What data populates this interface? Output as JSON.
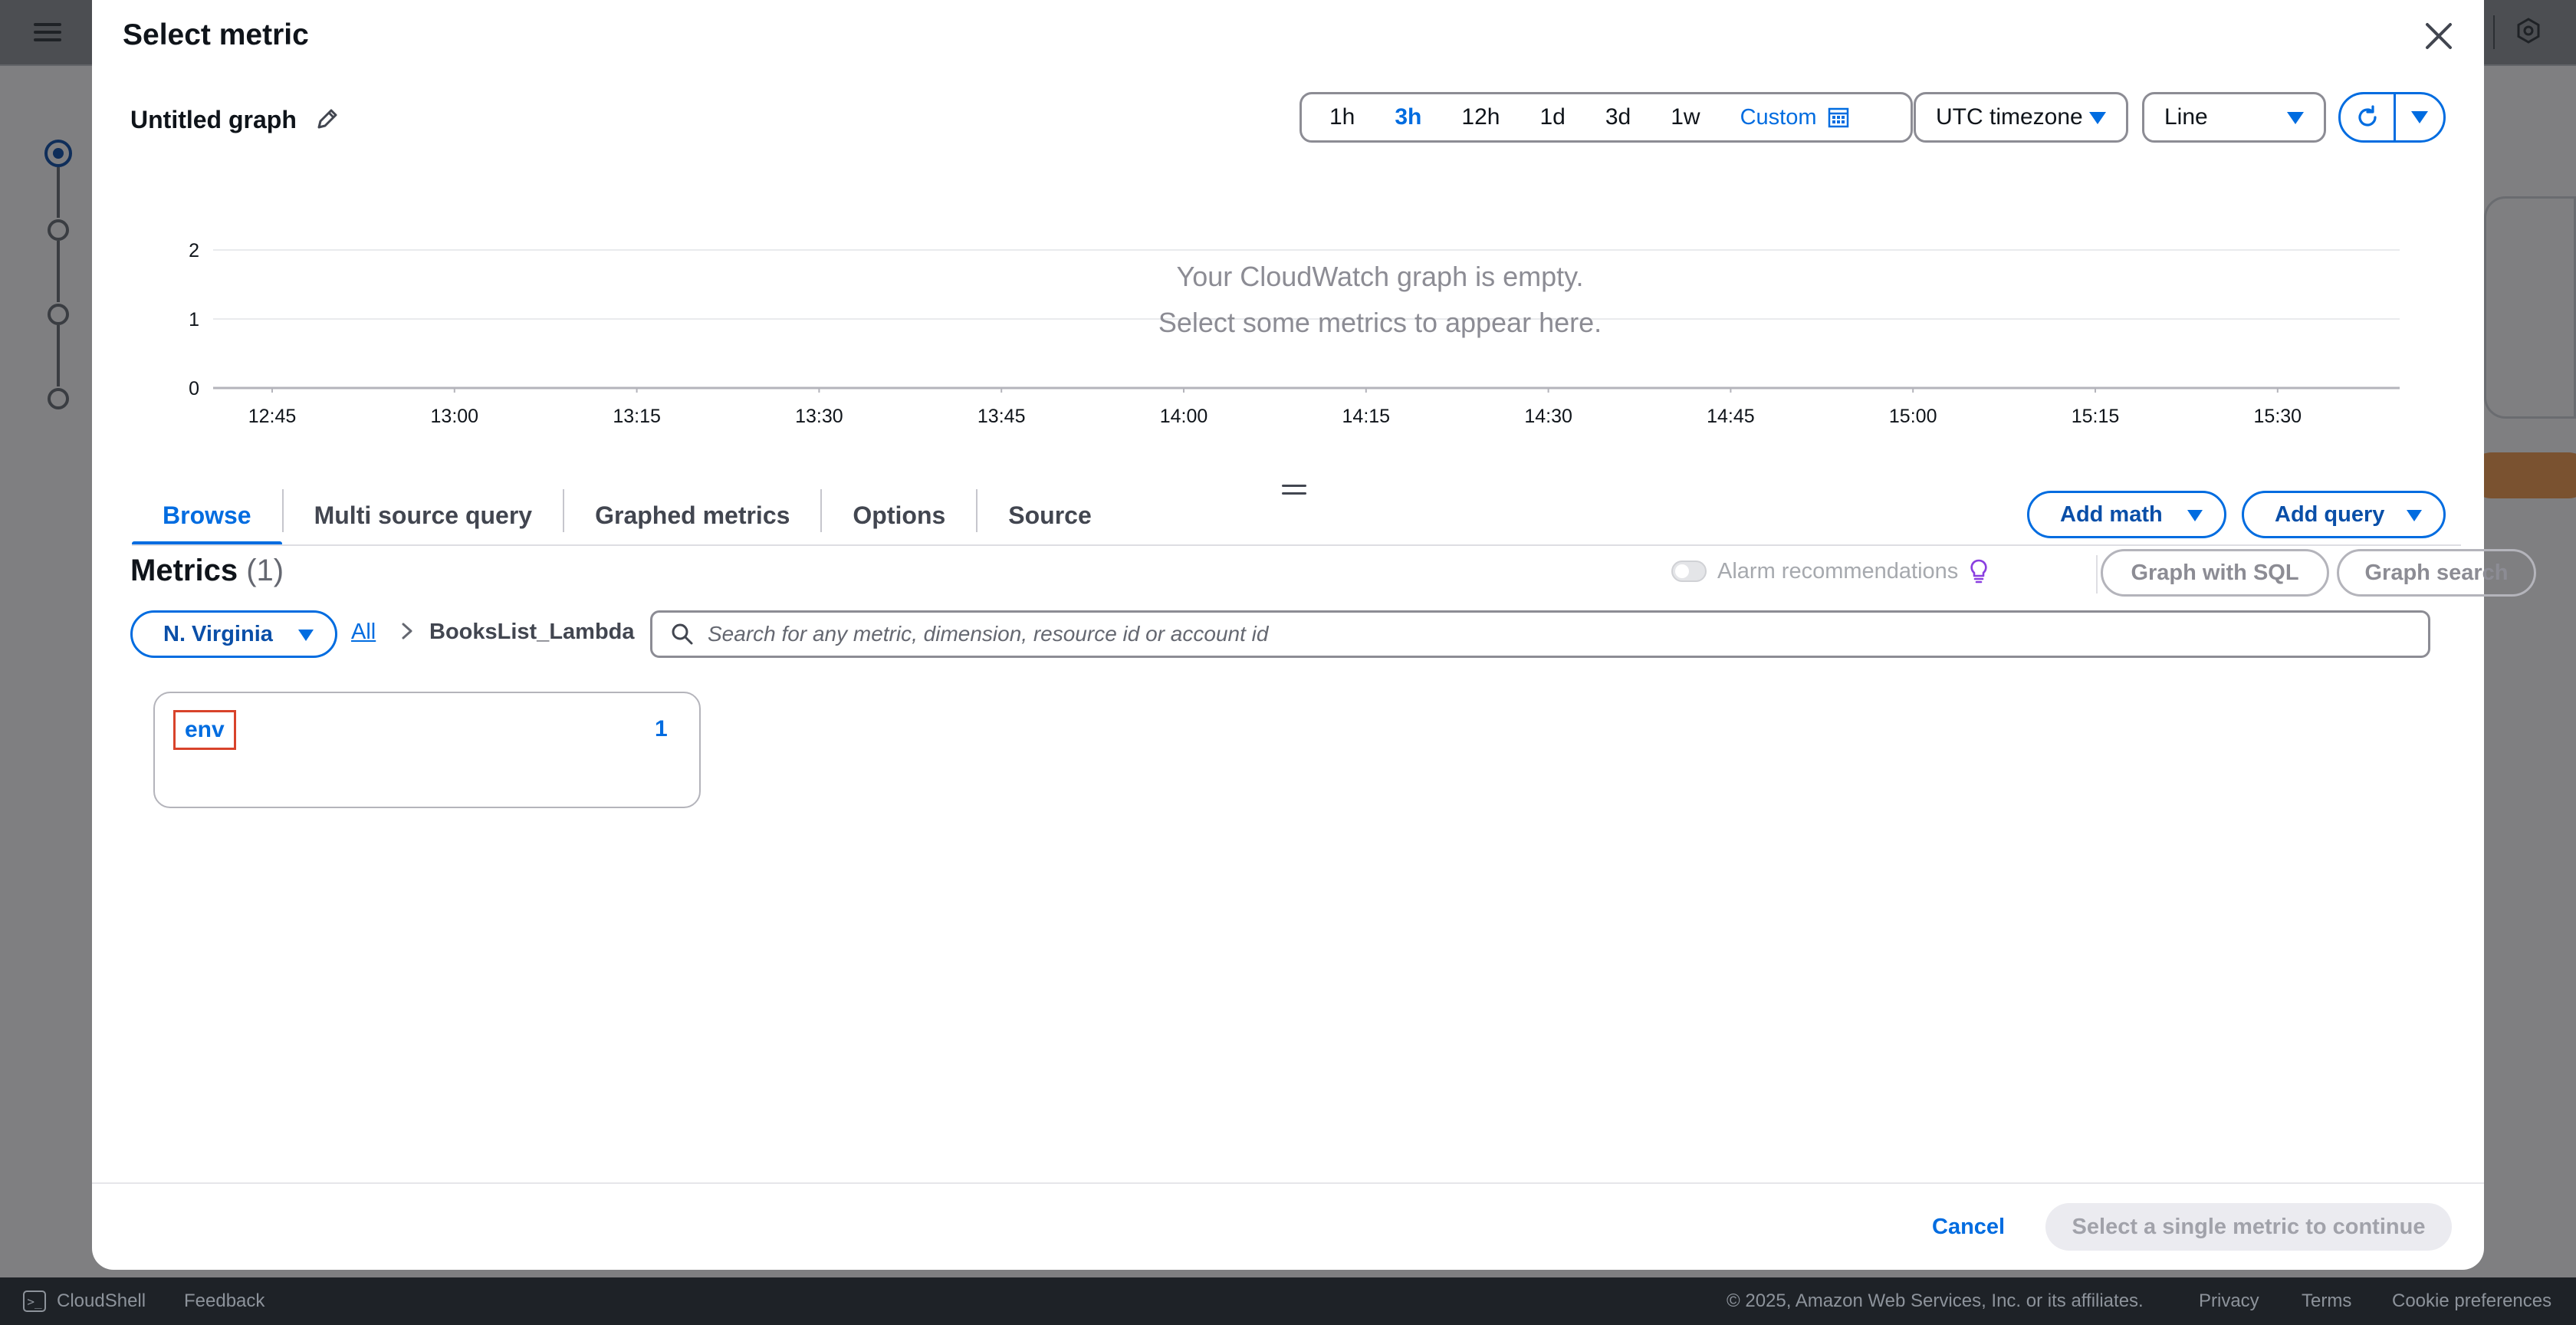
{
  "modal": {
    "title": "Select metric",
    "graph_title": "Untitled graph"
  },
  "time_range": {
    "options": [
      "1h",
      "3h",
      "12h",
      "1d",
      "3d",
      "1w"
    ],
    "selected": "3h",
    "custom_label": "Custom"
  },
  "timezone": {
    "value": "UTC timezone"
  },
  "graph_type": {
    "value": "Line"
  },
  "chart_data": {
    "type": "line",
    "x": [
      "12:45",
      "13:00",
      "13:15",
      "13:30",
      "13:45",
      "14:00",
      "14:15",
      "14:30",
      "14:45",
      "15:00",
      "15:15",
      "15:30"
    ],
    "y_ticks": [
      "2",
      "1",
      "0"
    ],
    "ylim": [
      0,
      2
    ],
    "series": [],
    "grid": true,
    "empty_message_line1": "Your CloudWatch graph is empty.",
    "empty_message_line2": "Select some metrics to appear here."
  },
  "tabs": [
    {
      "label": "Browse",
      "active": true
    },
    {
      "label": "Multi source query",
      "active": false
    },
    {
      "label": "Graphed metrics",
      "active": false
    },
    {
      "label": "Options",
      "active": false
    },
    {
      "label": "Source",
      "active": false
    }
  ],
  "actions": {
    "add_math": "Add math",
    "add_query": "Add query",
    "graph_with_sql": "Graph with SQL",
    "graph_search": "Graph search"
  },
  "metrics": {
    "title": "Metrics",
    "count": "(1)",
    "alarm_recommendations": "Alarm recommendations",
    "region": "N. Virginia",
    "breadcrumb_all": "All",
    "breadcrumb_current": "BooksList_Lambda",
    "search_placeholder": "Search for any metric, dimension, resource id or account id",
    "cards": [
      {
        "name": "env",
        "count": "1"
      }
    ]
  },
  "footer_buttons": {
    "cancel": "Cancel",
    "continue": "Select a single metric to continue"
  },
  "page_footer": {
    "cloudshell": "CloudShell",
    "feedback": "Feedback",
    "copyright": "© 2025, Amazon Web Services, Inc. or its affiliates.",
    "privacy": "Privacy",
    "terms": "Terms",
    "cookies": "Cookie preferences"
  },
  "colors": {
    "accent": "#006ce0",
    "overlay": "#7f7f81",
    "footer_bg": "#1e2227",
    "highlight_box": "#d8432b"
  }
}
